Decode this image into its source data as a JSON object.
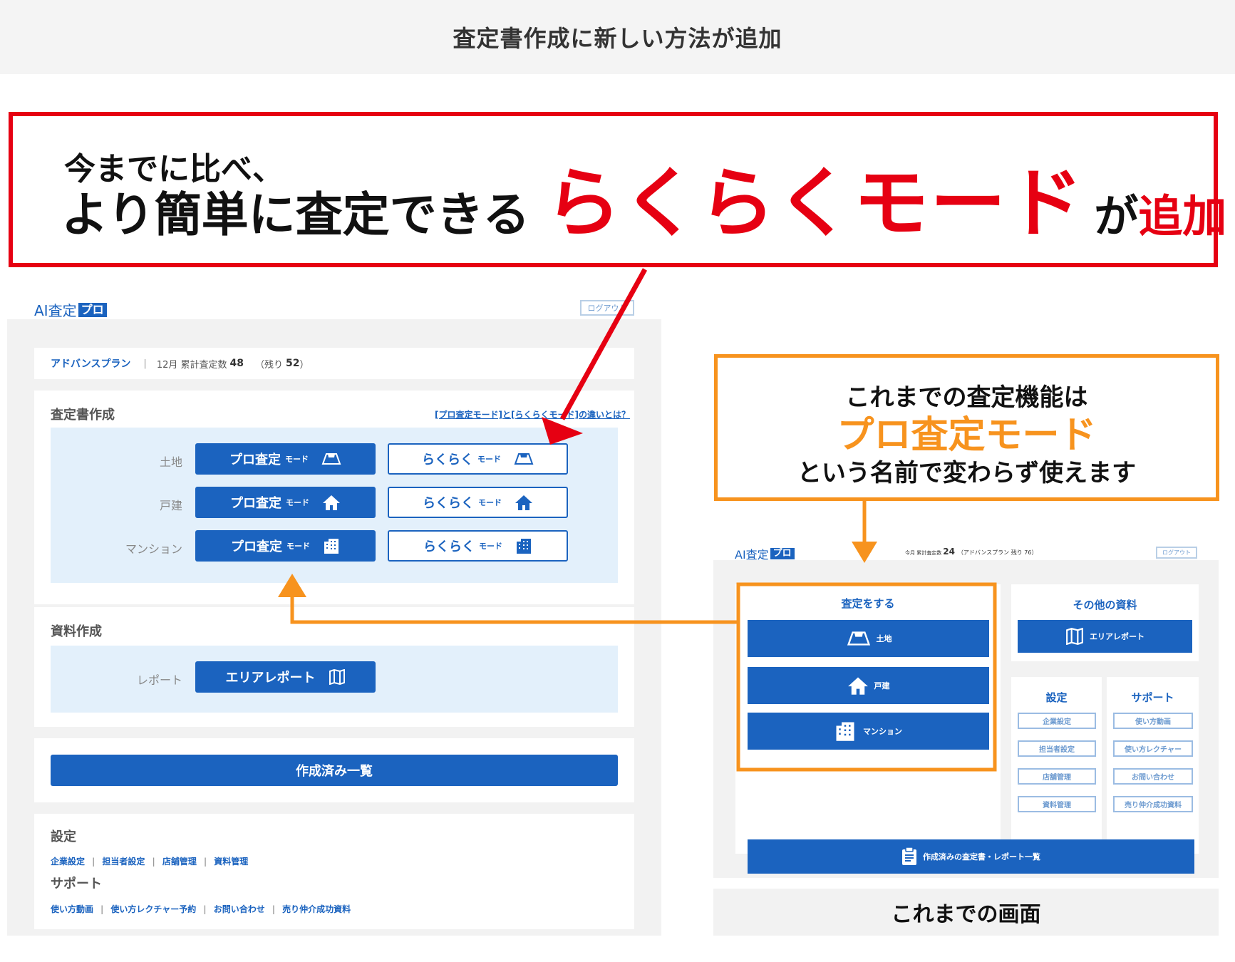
{
  "page_title": "査定書作成に新しい方法が追加",
  "headline": {
    "line1": "今までに比べ、",
    "line2_prefix": "より簡単に査定できる",
    "line2_highlight": "らくらくモード",
    "line2_particle": "が",
    "line2_suffix": "追加"
  },
  "new_screen": {
    "logo_main": "AI査定",
    "logo_pro": "プロ",
    "logout": "ログアウト",
    "plan": {
      "name": "アドバンスプラン",
      "separator": "|",
      "count_text": "12月 累計査定数",
      "count_value": "48",
      "remaining_text": "（残り",
      "remaining_value": "52",
      "remaining_close": "）"
    },
    "appraisal": {
      "title": "査定書作成",
      "help_link": "[プロ査定モード]と[らくらくモード]の違いとは？",
      "rows": [
        {
          "label": "土地",
          "pro": "プロ査定",
          "raku": "らくらく",
          "icon": "land-icon"
        },
        {
          "label": "戸建",
          "pro": "プロ査定",
          "raku": "らくらく",
          "icon": "house-icon"
        },
        {
          "label": "マンション",
          "pro": "プロ査定",
          "raku": "らくらく",
          "icon": "building-icon"
        }
      ],
      "mode_suffix": "モード"
    },
    "documents": {
      "title": "資料作成",
      "row_label": "レポート",
      "button": "エリアレポート"
    },
    "created_list": "作成済み一覧",
    "settings": {
      "title": "設定",
      "links": [
        "企業設定",
        "担当者設定",
        "店舗管理",
        "資料管理"
      ]
    },
    "support": {
      "title": "サポート",
      "links": [
        "使い方動画",
        "使い方レクチャー予約",
        "お問い合わせ",
        "売り仲介成功資料"
      ]
    }
  },
  "callout": {
    "line1": "これまでの査定機能は",
    "line2": "プロ査定モード",
    "line3": "という名前で変わらず使えます"
  },
  "old_screen": {
    "logo_main": "AI査定",
    "logo_pro": "プロ",
    "logout": "ログアウト",
    "status_prefix": "今月 累計査定数",
    "status_value": "24",
    "status_suffix": "（アドバンスプラン 残り 76）",
    "appraise_title": "査定をする",
    "appraise_buttons": [
      "土地",
      "戸建",
      "マンション"
    ],
    "other_title": "その他の資料",
    "area_report": "エリアレポート",
    "settings_title": "設定",
    "settings_buttons": [
      "企業設定",
      "担当者設定",
      "店舗管理",
      "資料管理"
    ],
    "support_title": "サポート",
    "support_buttons": [
      "使い方動画",
      "使い方レクチャー",
      "お問い合わせ",
      "売り仲介成功資料"
    ],
    "created_list": "作成済みの査定書・レポート一覧",
    "caption": "これまでの画面"
  },
  "colors": {
    "brand_blue": "#1b63bf",
    "accent_red": "#e60012",
    "accent_orange": "#f7931e",
    "panel_gray": "#f2f2f2",
    "light_blue": "#e3f0fb"
  }
}
